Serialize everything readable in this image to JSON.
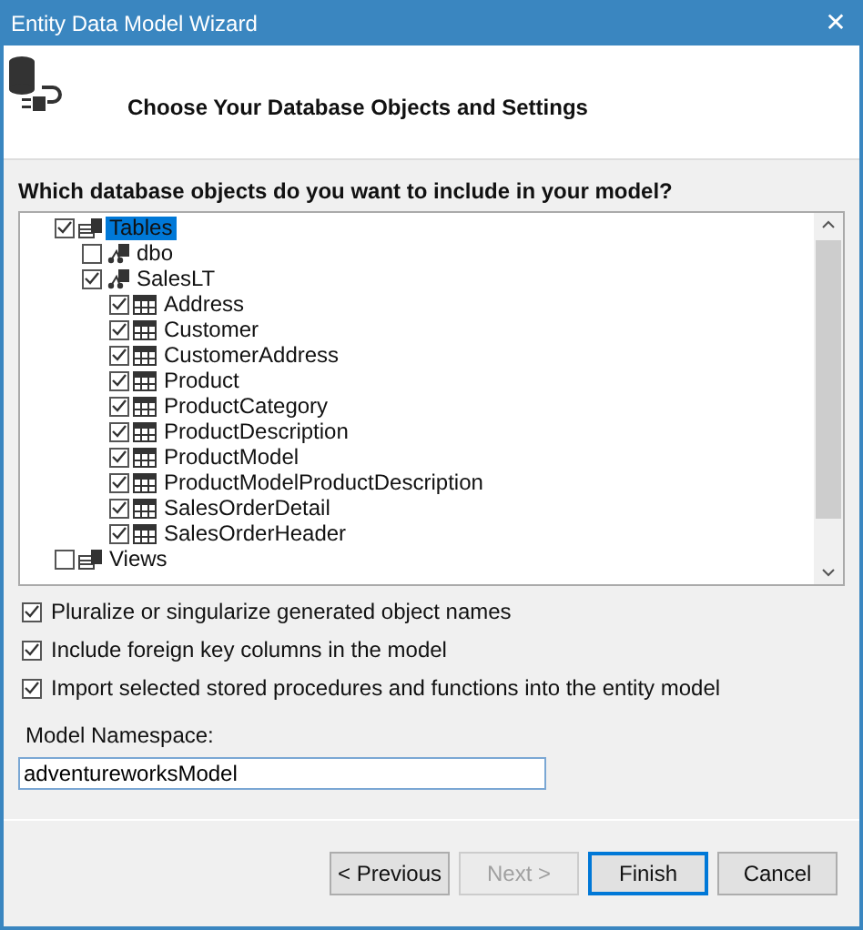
{
  "window": {
    "title": "Entity Data Model Wizard",
    "close": "✕"
  },
  "header": {
    "title": "Choose Your Database Objects and Settings"
  },
  "question": "Which database objects do you want to include in your model?",
  "tree": [
    {
      "label": "Tables",
      "kind": "group",
      "checked": true,
      "selected": true,
      "children": [
        {
          "label": "dbo",
          "kind": "schema",
          "checked": false,
          "selected": false
        },
        {
          "label": "SalesLT",
          "kind": "schema",
          "checked": true,
          "selected": false,
          "children": [
            {
              "label": "Address",
              "kind": "table",
              "checked": true,
              "selected": false
            },
            {
              "label": "Customer",
              "kind": "table",
              "checked": true,
              "selected": false
            },
            {
              "label": "CustomerAddress",
              "kind": "table",
              "checked": true,
              "selected": false
            },
            {
              "label": "Product",
              "kind": "table",
              "checked": true,
              "selected": false
            },
            {
              "label": "ProductCategory",
              "kind": "table",
              "checked": true,
              "selected": false
            },
            {
              "label": "ProductDescription",
              "kind": "table",
              "checked": true,
              "selected": false
            },
            {
              "label": "ProductModel",
              "kind": "table",
              "checked": true,
              "selected": false
            },
            {
              "label": "ProductModelProductDescription",
              "kind": "table",
              "checked": true,
              "selected": false
            },
            {
              "label": "SalesOrderDetail",
              "kind": "table",
              "checked": true,
              "selected": false
            },
            {
              "label": "SalesOrderHeader",
              "kind": "table",
              "checked": true,
              "selected": false
            }
          ]
        }
      ]
    },
    {
      "label": "Views",
      "kind": "group",
      "checked": false,
      "selected": false
    }
  ],
  "options": [
    {
      "label": "Pluralize or singularize generated object names",
      "checked": true
    },
    {
      "label": "Include foreign key columns in the model",
      "checked": true
    },
    {
      "label": "Import selected stored procedures and functions into the entity model",
      "checked": true
    }
  ],
  "namespace": {
    "label": "Model Namespace:",
    "value": "adventureworksModel"
  },
  "buttons": [
    {
      "label": "< Previous",
      "disabled": false,
      "default": false
    },
    {
      "label": "Next >",
      "disabled": true,
      "default": false
    },
    {
      "label": "Finish",
      "disabled": false,
      "default": true
    },
    {
      "label": "Cancel",
      "disabled": false,
      "default": false
    }
  ]
}
